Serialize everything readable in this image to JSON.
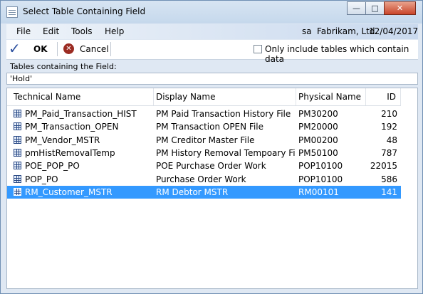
{
  "window": {
    "title": "Select Table Containing Field",
    "minimize_glyph": "—",
    "maximize_glyph": "□",
    "close_glyph": "✕"
  },
  "menu": {
    "items": [
      "File",
      "Edit",
      "Tools",
      "Help"
    ],
    "user": "sa",
    "company": "Fabrikam, Ltd.",
    "date": "12/04/2017"
  },
  "toolbar": {
    "ok_label": "OK",
    "cancel_label": "Cancel",
    "only_include_label": "Only include tables which contain data",
    "only_include_checked": false
  },
  "field": {
    "label": "Tables containing the Field:",
    "value": "'Hold'"
  },
  "table": {
    "columns": [
      "Technical Name",
      "Display Name",
      "Physical Name",
      "ID"
    ],
    "rows": [
      {
        "technical": "PM_Paid_Transaction_HIST",
        "display": "PM Paid Transaction History File",
        "physical": "PM30200",
        "id": "210",
        "selected": false
      },
      {
        "technical": "PM_Transaction_OPEN",
        "display": "PM Transaction OPEN File",
        "physical": "PM20000",
        "id": "192",
        "selected": false
      },
      {
        "technical": "PM_Vendor_MSTR",
        "display": "PM Creditor Master File",
        "physical": "PM00200",
        "id": "48",
        "selected": false
      },
      {
        "technical": "pmHistRemovalTemp",
        "display": "PM History Removal Tempoary File",
        "physical": "PM50100",
        "id": "787",
        "selected": false
      },
      {
        "technical": "POE_POP_PO",
        "display": "POE Purchase Order Work",
        "physical": "POP10100",
        "id": "22015",
        "selected": false
      },
      {
        "technical": "POP_PO",
        "display": "Purchase Order Work",
        "physical": "POP10100",
        "id": "586",
        "selected": false
      },
      {
        "technical": "RM_Customer_MSTR",
        "display": "RM Debtor MSTR",
        "physical": "RM00101",
        "id": "141",
        "selected": true
      }
    ]
  },
  "colors": {
    "selection": "#3399ff",
    "menubar_gradient_end": "#c9d9ee",
    "ok_check": "#2b4f9e",
    "cancel_icon": "#9b2b22"
  }
}
